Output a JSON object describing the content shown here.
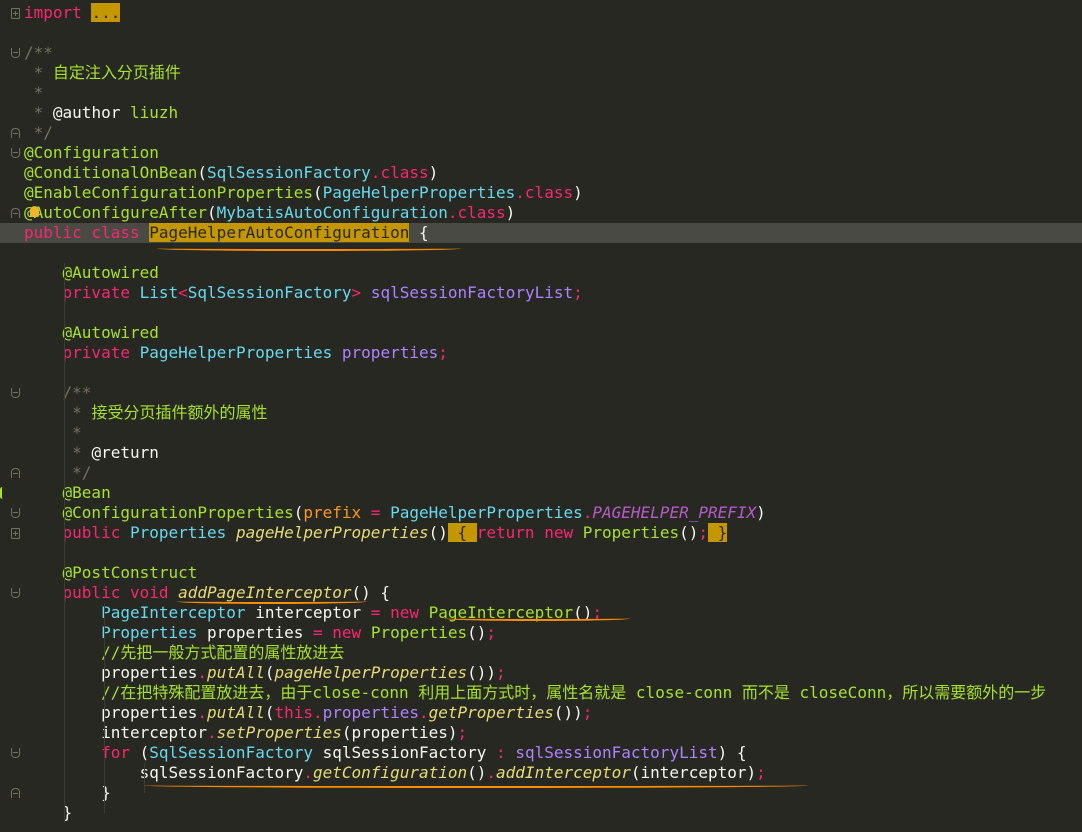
{
  "editor": {
    "language": "java",
    "theme": "monokai",
    "colors": {
      "background": "#272822",
      "current_line": "#494a43",
      "underline": "#ff8c00",
      "keyword": "#f92672",
      "type": "#66d9ef",
      "annotation": "#a6e22e",
      "comment": "#75715e",
      "method_italic": "#e6db74",
      "field": "#ae81ff"
    },
    "lines": [
      {
        "fold": "closed-start",
        "tokens": [
          [
            "k",
            "import"
          ],
          [
            "p",
            " "
          ],
          [
            "sel",
            "..."
          ]
        ]
      },
      {
        "fold": "",
        "tokens": []
      },
      {
        "fold": "open-start",
        "tokens": [
          [
            "c",
            "/**"
          ]
        ]
      },
      {
        "fold": "",
        "tokens": [
          [
            "c",
            " * "
          ],
          [
            "cz",
            "自定注入分页插件"
          ]
        ]
      },
      {
        "fold": "",
        "tokens": [
          [
            "c",
            " *"
          ]
        ]
      },
      {
        "fold": "",
        "tokens": [
          [
            "c",
            " * "
          ],
          [
            "p",
            "@author"
          ],
          [
            "c",
            " "
          ],
          [
            "cz",
            "liuzh"
          ]
        ]
      },
      {
        "fold": "open-end",
        "tokens": [
          [
            "c",
            " */"
          ]
        ]
      },
      {
        "fold": "open-start",
        "tokens": [
          [
            "a",
            "@Configuration"
          ]
        ]
      },
      {
        "fold": "",
        "tokens": [
          [
            "a",
            "@ConditionalOnBean"
          ],
          [
            "p",
            "("
          ],
          [
            "t",
            "SqlSessionFactory"
          ],
          [
            "k",
            "."
          ],
          [
            "k",
            "class"
          ],
          [
            "p",
            ")"
          ]
        ]
      },
      {
        "fold": "",
        "tokens": [
          [
            "a",
            "@EnableConfigurationProperties"
          ],
          [
            "p",
            "("
          ],
          [
            "t",
            "PageHelperProperties"
          ],
          [
            "k",
            "."
          ],
          [
            "k",
            "class"
          ],
          [
            "p",
            ")"
          ]
        ]
      },
      {
        "fold": "open-end",
        "bulb": true,
        "tokens": [
          [
            "a",
            "@AutoConfigureAfter"
          ],
          [
            "p",
            "("
          ],
          [
            "t",
            "MybatisAutoConfiguration"
          ],
          [
            "k",
            "."
          ],
          [
            "k",
            "class"
          ],
          [
            "p",
            ")"
          ]
        ]
      },
      {
        "fold": "",
        "highlight": true,
        "tokens": [
          [
            "k",
            "public"
          ],
          [
            "p",
            " "
          ],
          [
            "k",
            "class"
          ],
          [
            "p",
            " "
          ],
          [
            "sel",
            "PageHelperAutoConfiguration"
          ],
          [
            "p",
            " {"
          ]
        ]
      },
      {
        "fold": "",
        "tokens": []
      },
      {
        "fold": "",
        "tokens": [
          [
            "p",
            "    "
          ],
          [
            "a",
            "@Autowired"
          ]
        ]
      },
      {
        "fold": "",
        "tokens": [
          [
            "p",
            "    "
          ],
          [
            "k",
            "private"
          ],
          [
            "p",
            " "
          ],
          [
            "t",
            "List"
          ],
          [
            "k",
            "<"
          ],
          [
            "t",
            "SqlSessionFactory"
          ],
          [
            "k",
            ">"
          ],
          [
            "p",
            " "
          ],
          [
            "fld",
            "sqlSessionFactoryList"
          ],
          [
            "k",
            ";"
          ]
        ]
      },
      {
        "fold": "",
        "tokens": []
      },
      {
        "fold": "",
        "tokens": [
          [
            "p",
            "    "
          ],
          [
            "a",
            "@Autowired"
          ]
        ]
      },
      {
        "fold": "",
        "tokens": [
          [
            "p",
            "    "
          ],
          [
            "k",
            "private"
          ],
          [
            "p",
            " "
          ],
          [
            "t",
            "PageHelperProperties"
          ],
          [
            "p",
            " "
          ],
          [
            "fld",
            "properties"
          ],
          [
            "k",
            ";"
          ]
        ]
      },
      {
        "fold": "",
        "tokens": []
      },
      {
        "fold": "open-start",
        "tokens": [
          [
            "p",
            "    "
          ],
          [
            "c",
            "/**"
          ]
        ]
      },
      {
        "fold": "",
        "tokens": [
          [
            "p",
            "    "
          ],
          [
            "c",
            " * "
          ],
          [
            "cz",
            "接受分页插件额外的属性"
          ]
        ]
      },
      {
        "fold": "",
        "tokens": [
          [
            "p",
            "    "
          ],
          [
            "c",
            " *"
          ]
        ]
      },
      {
        "fold": "",
        "tokens": [
          [
            "p",
            "    "
          ],
          [
            "c",
            " * "
          ],
          [
            "p",
            "@return"
          ]
        ]
      },
      {
        "fold": "open-end",
        "tokens": [
          [
            "p",
            "    "
          ],
          [
            "c",
            " */"
          ]
        ]
      },
      {
        "fold": "",
        "mark": true,
        "tokens": [
          [
            "p",
            "    "
          ],
          [
            "a",
            "@Bean"
          ]
        ]
      },
      {
        "fold": "open-start",
        "tokens": [
          [
            "p",
            "    "
          ],
          [
            "a",
            "@ConfigurationProperties"
          ],
          [
            "p",
            "("
          ],
          [
            "param",
            "prefix"
          ],
          [
            "p",
            " "
          ],
          [
            "k",
            "="
          ],
          [
            "p",
            " "
          ],
          [
            "t",
            "PageHelperProperties"
          ],
          [
            "k",
            "."
          ],
          [
            "const",
            "PAGEHELPER_PREFIX"
          ],
          [
            "p",
            ")"
          ]
        ]
      },
      {
        "fold": "closed-start",
        "tokens": [
          [
            "p",
            "    "
          ],
          [
            "k",
            "public"
          ],
          [
            "p",
            " "
          ],
          [
            "t",
            "Properties"
          ],
          [
            "p",
            " "
          ],
          [
            "fi",
            "pageHelperProperties"
          ],
          [
            "p",
            "()"
          ],
          [
            "sel",
            " { "
          ],
          [
            "k",
            "return"
          ],
          [
            "p",
            " "
          ],
          [
            "k",
            "new"
          ],
          [
            "p",
            " "
          ],
          [
            "a",
            "Properties"
          ],
          [
            "p",
            "()"
          ],
          [
            "k",
            ";"
          ],
          [
            "sel",
            " }"
          ]
        ]
      },
      {
        "fold": "",
        "tokens": []
      },
      {
        "fold": "",
        "tokens": [
          [
            "p",
            "    "
          ],
          [
            "a",
            "@PostConstruct"
          ]
        ]
      },
      {
        "fold": "open-start",
        "tokens": [
          [
            "p",
            "    "
          ],
          [
            "k",
            "public"
          ],
          [
            "p",
            " "
          ],
          [
            "k",
            "void"
          ],
          [
            "p",
            " "
          ],
          [
            "fi",
            "addPageInterceptor"
          ],
          [
            "p",
            "() {"
          ]
        ]
      },
      {
        "fold": "",
        "tokens": [
          [
            "p",
            "        "
          ],
          [
            "t",
            "PageInterceptor"
          ],
          [
            "p",
            " interceptor "
          ],
          [
            "k",
            "="
          ],
          [
            "p",
            " "
          ],
          [
            "k",
            "new"
          ],
          [
            "p",
            " "
          ],
          [
            "a",
            "PageInterceptor"
          ],
          [
            "p",
            "()"
          ],
          [
            "k",
            ";"
          ]
        ]
      },
      {
        "fold": "",
        "tokens": [
          [
            "p",
            "        "
          ],
          [
            "t",
            "Properties"
          ],
          [
            "p",
            " properties "
          ],
          [
            "k",
            "="
          ],
          [
            "p",
            " "
          ],
          [
            "k",
            "new"
          ],
          [
            "p",
            " "
          ],
          [
            "a",
            "Properties"
          ],
          [
            "p",
            "()"
          ],
          [
            "k",
            ";"
          ]
        ]
      },
      {
        "fold": "",
        "tokens": [
          [
            "p",
            "        "
          ],
          [
            "cz",
            "//先把一般方式配置的属性放进去"
          ]
        ]
      },
      {
        "fold": "",
        "tokens": [
          [
            "p",
            "        properties"
          ],
          [
            "k",
            "."
          ],
          [
            "fi",
            "putAll"
          ],
          [
            "p",
            "("
          ],
          [
            "fi",
            "pageHelperProperties"
          ],
          [
            "p",
            "())"
          ],
          [
            "k",
            ";"
          ]
        ]
      },
      {
        "fold": "",
        "tokens": [
          [
            "p",
            "        "
          ],
          [
            "cz",
            "//在把特殊配置放进去，由于close-conn 利用上面方式时，属性名就是 close-conn 而不是 closeConn，所以需要额外的一步"
          ]
        ]
      },
      {
        "fold": "",
        "tokens": [
          [
            "p",
            "        properties"
          ],
          [
            "k",
            "."
          ],
          [
            "fi",
            "putAll"
          ],
          [
            "p",
            "("
          ],
          [
            "k",
            "this"
          ],
          [
            "k",
            "."
          ],
          [
            "fld",
            "properties"
          ],
          [
            "k",
            "."
          ],
          [
            "fi",
            "getProperties"
          ],
          [
            "p",
            "())"
          ],
          [
            "k",
            ";"
          ]
        ]
      },
      {
        "fold": "",
        "tokens": [
          [
            "p",
            "        interceptor"
          ],
          [
            "k",
            "."
          ],
          [
            "fi",
            "setProperties"
          ],
          [
            "p",
            "(properties)"
          ],
          [
            "k",
            ";"
          ]
        ]
      },
      {
        "fold": "open-start",
        "tokens": [
          [
            "p",
            "        "
          ],
          [
            "k",
            "for"
          ],
          [
            "p",
            " ("
          ],
          [
            "t",
            "SqlSessionFactory"
          ],
          [
            "p",
            " sqlSessionFactory "
          ],
          [
            "k",
            ":"
          ],
          [
            "p",
            " "
          ],
          [
            "fld",
            "sqlSessionFactoryList"
          ],
          [
            "p",
            ") {"
          ]
        ]
      },
      {
        "fold": "",
        "tokens": [
          [
            "p",
            "            sqlSessionFactory"
          ],
          [
            "k",
            "."
          ],
          [
            "fi",
            "getConfiguration"
          ],
          [
            "p",
            "()"
          ],
          [
            "k",
            "."
          ],
          [
            "fi",
            "addInterceptor"
          ],
          [
            "p",
            "(interceptor)"
          ],
          [
            "k",
            ";"
          ]
        ]
      },
      {
        "fold": "open-end",
        "tokens": [
          [
            "p",
            "        }"
          ]
        ]
      },
      {
        "fold": "",
        "tokens": [
          [
            "p",
            "    }"
          ]
        ]
      }
    ]
  }
}
